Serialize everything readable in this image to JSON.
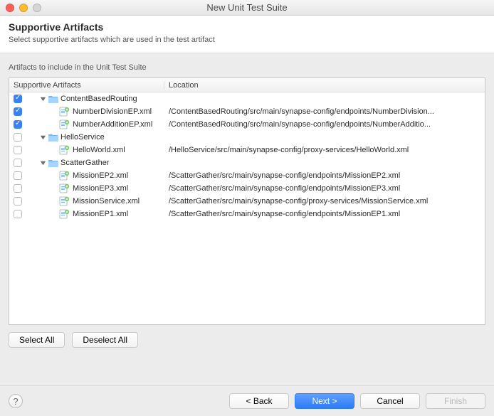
{
  "window": {
    "title": "New Unit Test Suite"
  },
  "header": {
    "title": "Supportive Artifacts",
    "subtitle": "Select supportive artifacts which are used in the test artifact"
  },
  "section_label": "Artifacts to include in the Unit Test Suite",
  "columns": {
    "artifacts": "Supportive Artifacts",
    "location": "Location"
  },
  "rows": [
    {
      "type": "folder",
      "depth": 1,
      "checked": true,
      "label": "ContentBasedRouting",
      "location": ""
    },
    {
      "type": "file",
      "depth": 2,
      "checked": true,
      "label": "NumberDivisionEP.xml",
      "location": "/ContentBasedRouting/src/main/synapse-config/endpoints/NumberDivision..."
    },
    {
      "type": "file",
      "depth": 2,
      "checked": true,
      "label": "NumberAdditionEP.xml",
      "location": "/ContentBasedRouting/src/main/synapse-config/endpoints/NumberAdditio..."
    },
    {
      "type": "folder",
      "depth": 1,
      "checked": false,
      "label": "HelloService",
      "location": ""
    },
    {
      "type": "file",
      "depth": 2,
      "checked": false,
      "label": "HelloWorld.xml",
      "location": "/HelloService/src/main/synapse-config/proxy-services/HelloWorld.xml"
    },
    {
      "type": "folder",
      "depth": 1,
      "checked": false,
      "label": "ScatterGather",
      "location": ""
    },
    {
      "type": "file",
      "depth": 2,
      "checked": false,
      "label": "MissionEP2.xml",
      "location": "/ScatterGather/src/main/synapse-config/endpoints/MissionEP2.xml"
    },
    {
      "type": "file",
      "depth": 2,
      "checked": false,
      "label": "MissionEP3.xml",
      "location": "/ScatterGather/src/main/synapse-config/endpoints/MissionEP3.xml"
    },
    {
      "type": "file",
      "depth": 2,
      "checked": false,
      "label": "MissionService.xml",
      "location": "/ScatterGather/src/main/synapse-config/proxy-services/MissionService.xml"
    },
    {
      "type": "file",
      "depth": 2,
      "checked": false,
      "label": "MissionEP1.xml",
      "location": "/ScatterGather/src/main/synapse-config/endpoints/MissionEP1.xml"
    }
  ],
  "buttons": {
    "select_all": "Select All",
    "deselect_all": "Deselect All",
    "back": "< Back",
    "next": "Next >",
    "cancel": "Cancel",
    "finish": "Finish"
  }
}
